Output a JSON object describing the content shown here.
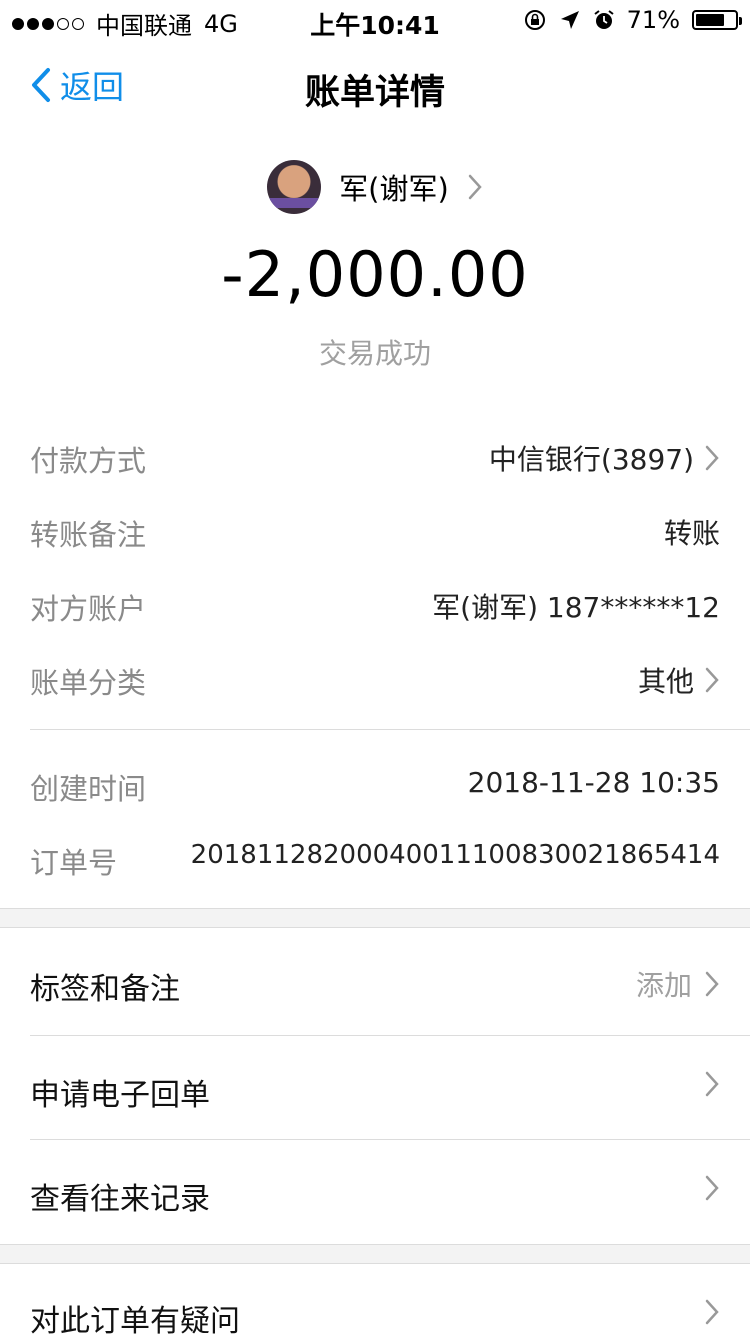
{
  "status_bar": {
    "carrier": "中国联通",
    "network": "4G",
    "time": "上午10:41",
    "battery": "71%"
  },
  "nav": {
    "back_label": "返回",
    "title": "账单详情"
  },
  "payee": {
    "name": "军(谢军)"
  },
  "transaction": {
    "amount": "-2,000.00",
    "status": "交易成功"
  },
  "details": [
    {
      "label": "付款方式",
      "value": "中信银行(3897)"
    },
    {
      "label": "转账备注",
      "value": "转账"
    },
    {
      "label": "对方账户",
      "value": "军(谢军) 187******12"
    },
    {
      "label": "账单分类",
      "value": "其他"
    },
    {
      "label": "创建时间",
      "value": "2018-11-28 10:35"
    },
    {
      "label": "订单号",
      "value": "20181128200040011100830021865414"
    }
  ],
  "menu": [
    {
      "label": "标签和备注",
      "right_text": "添加"
    },
    {
      "label": "申请电子回单"
    },
    {
      "label": "查看往来记录"
    },
    {
      "label": "对此订单有疑问"
    }
  ],
  "colors": {
    "accent": "#108ee9",
    "label_gray": "#8a8a8a",
    "section_gap": "#f3f3f3"
  }
}
